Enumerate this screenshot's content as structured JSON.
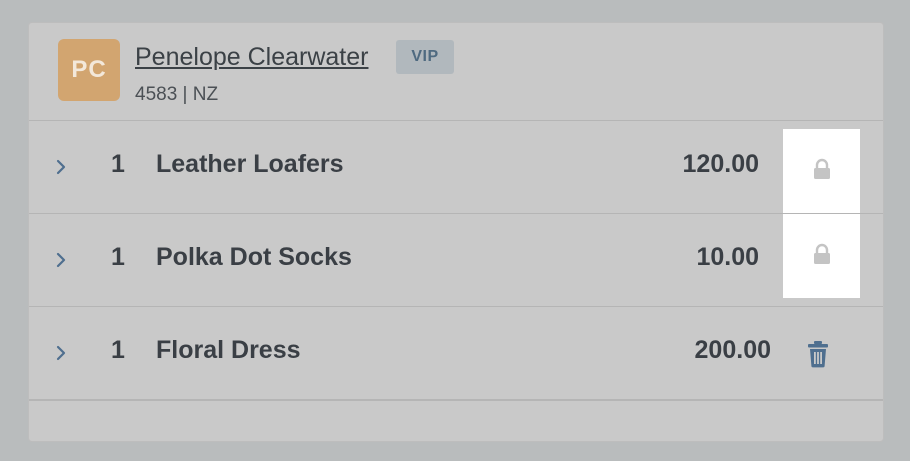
{
  "customer": {
    "initials": "PC",
    "name": "Penelope Clearwater",
    "badge": "VIP",
    "meta": "4583 | NZ"
  },
  "items": [
    {
      "qty": "1",
      "name": "Leather Loafers",
      "price": "120.00",
      "action": "lock-icon"
    },
    {
      "qty": "1",
      "name": "Polka Dot Socks",
      "price": "10.00",
      "action": "lock-icon"
    },
    {
      "qty": "1",
      "name": "Floral Dress",
      "price": "200.00",
      "action": "trash-icon"
    }
  ],
  "colors": {
    "background": "#b9bcbd",
    "panel": "#c9c9c9",
    "avatar": "#d2a570",
    "badge": "#b1b8bd",
    "accent": "#4f6f8f"
  }
}
